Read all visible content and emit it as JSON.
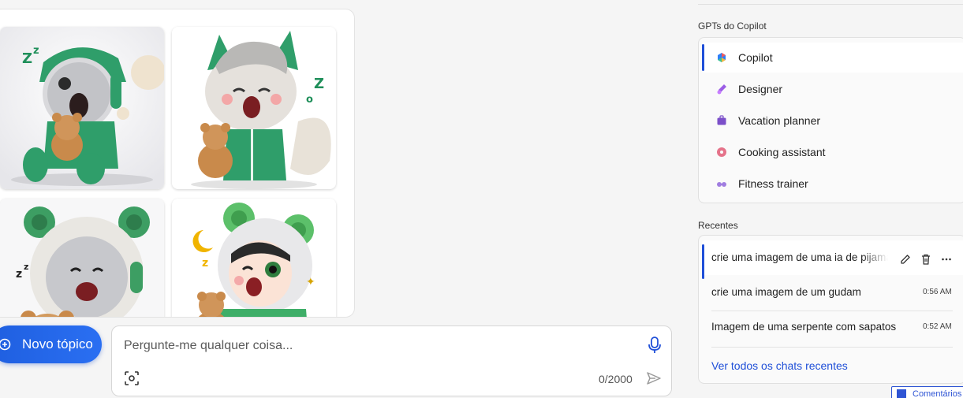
{
  "images": [
    {
      "name": "sleeping-robot-with-teddy",
      "alt": ""
    },
    {
      "name": "sleepy-fox-with-teddy",
      "alt": ""
    },
    {
      "name": "laughing-robot-bear",
      "alt": ""
    },
    {
      "name": "yawning-child-bear-hood",
      "alt": ""
    }
  ],
  "bottom_bar": {
    "new_topic_label": "Novo tópico",
    "input_placeholder": "Pergunte-me qualquer coisa...",
    "input_value": "",
    "char_counter": "0/2000"
  },
  "gpts": {
    "section_label": "GPTs do Copilot",
    "items": [
      {
        "label": "Copilot",
        "icon": "copilot-icon",
        "active": true
      },
      {
        "label": "Designer",
        "icon": "designer-icon",
        "active": false
      },
      {
        "label": "Vacation planner",
        "icon": "suitcase-icon",
        "active": false
      },
      {
        "label": "Cooking assistant",
        "icon": "donut-icon",
        "active": false
      },
      {
        "label": "Fitness trainer",
        "icon": "dumbbell-icon",
        "active": false
      }
    ]
  },
  "recents": {
    "section_label": "Recentes",
    "items": [
      {
        "title": "crie uma imagem de uma ia de pijama",
        "time": "",
        "active": true
      },
      {
        "title": "crie uma imagem de um gudam",
        "time": "0:56 AM",
        "active": false
      },
      {
        "title": "Imagem de uma serpente com sapatos",
        "time": "0:52 AM",
        "active": false
      }
    ],
    "see_all_label": "Ver todos os chats recentes"
  },
  "feedback_label": "Comentários",
  "colors": {
    "accent": "#1f4fd8",
    "button_gradient_start": "#1f5fe0",
    "character_green": "#2f9e6a"
  }
}
